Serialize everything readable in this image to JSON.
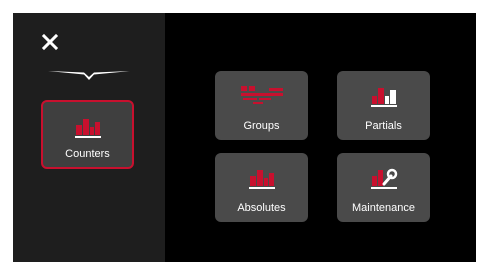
{
  "sidebar": {
    "close_icon": "close-icon",
    "logo_icon": "chevron-wing-logo",
    "selected": {
      "label": "Counters",
      "icon": "bar-chart-icon"
    }
  },
  "menu": {
    "groups": {
      "label": "Groups",
      "icon": "groups-icon"
    },
    "partials": {
      "label": "Partials",
      "icon": "bar-chart-icon"
    },
    "absolutes": {
      "label": "Absolutes",
      "icon": "bar-chart-icon"
    },
    "maintenance": {
      "label": "Maintenance",
      "icon": "wrench-chart-icon"
    }
  },
  "colors": {
    "accent": "#c8102e",
    "tile": "#4a4a4a",
    "sidebar": "#1e1e1e",
    "background": "#000000",
    "text": "#ffffff"
  }
}
